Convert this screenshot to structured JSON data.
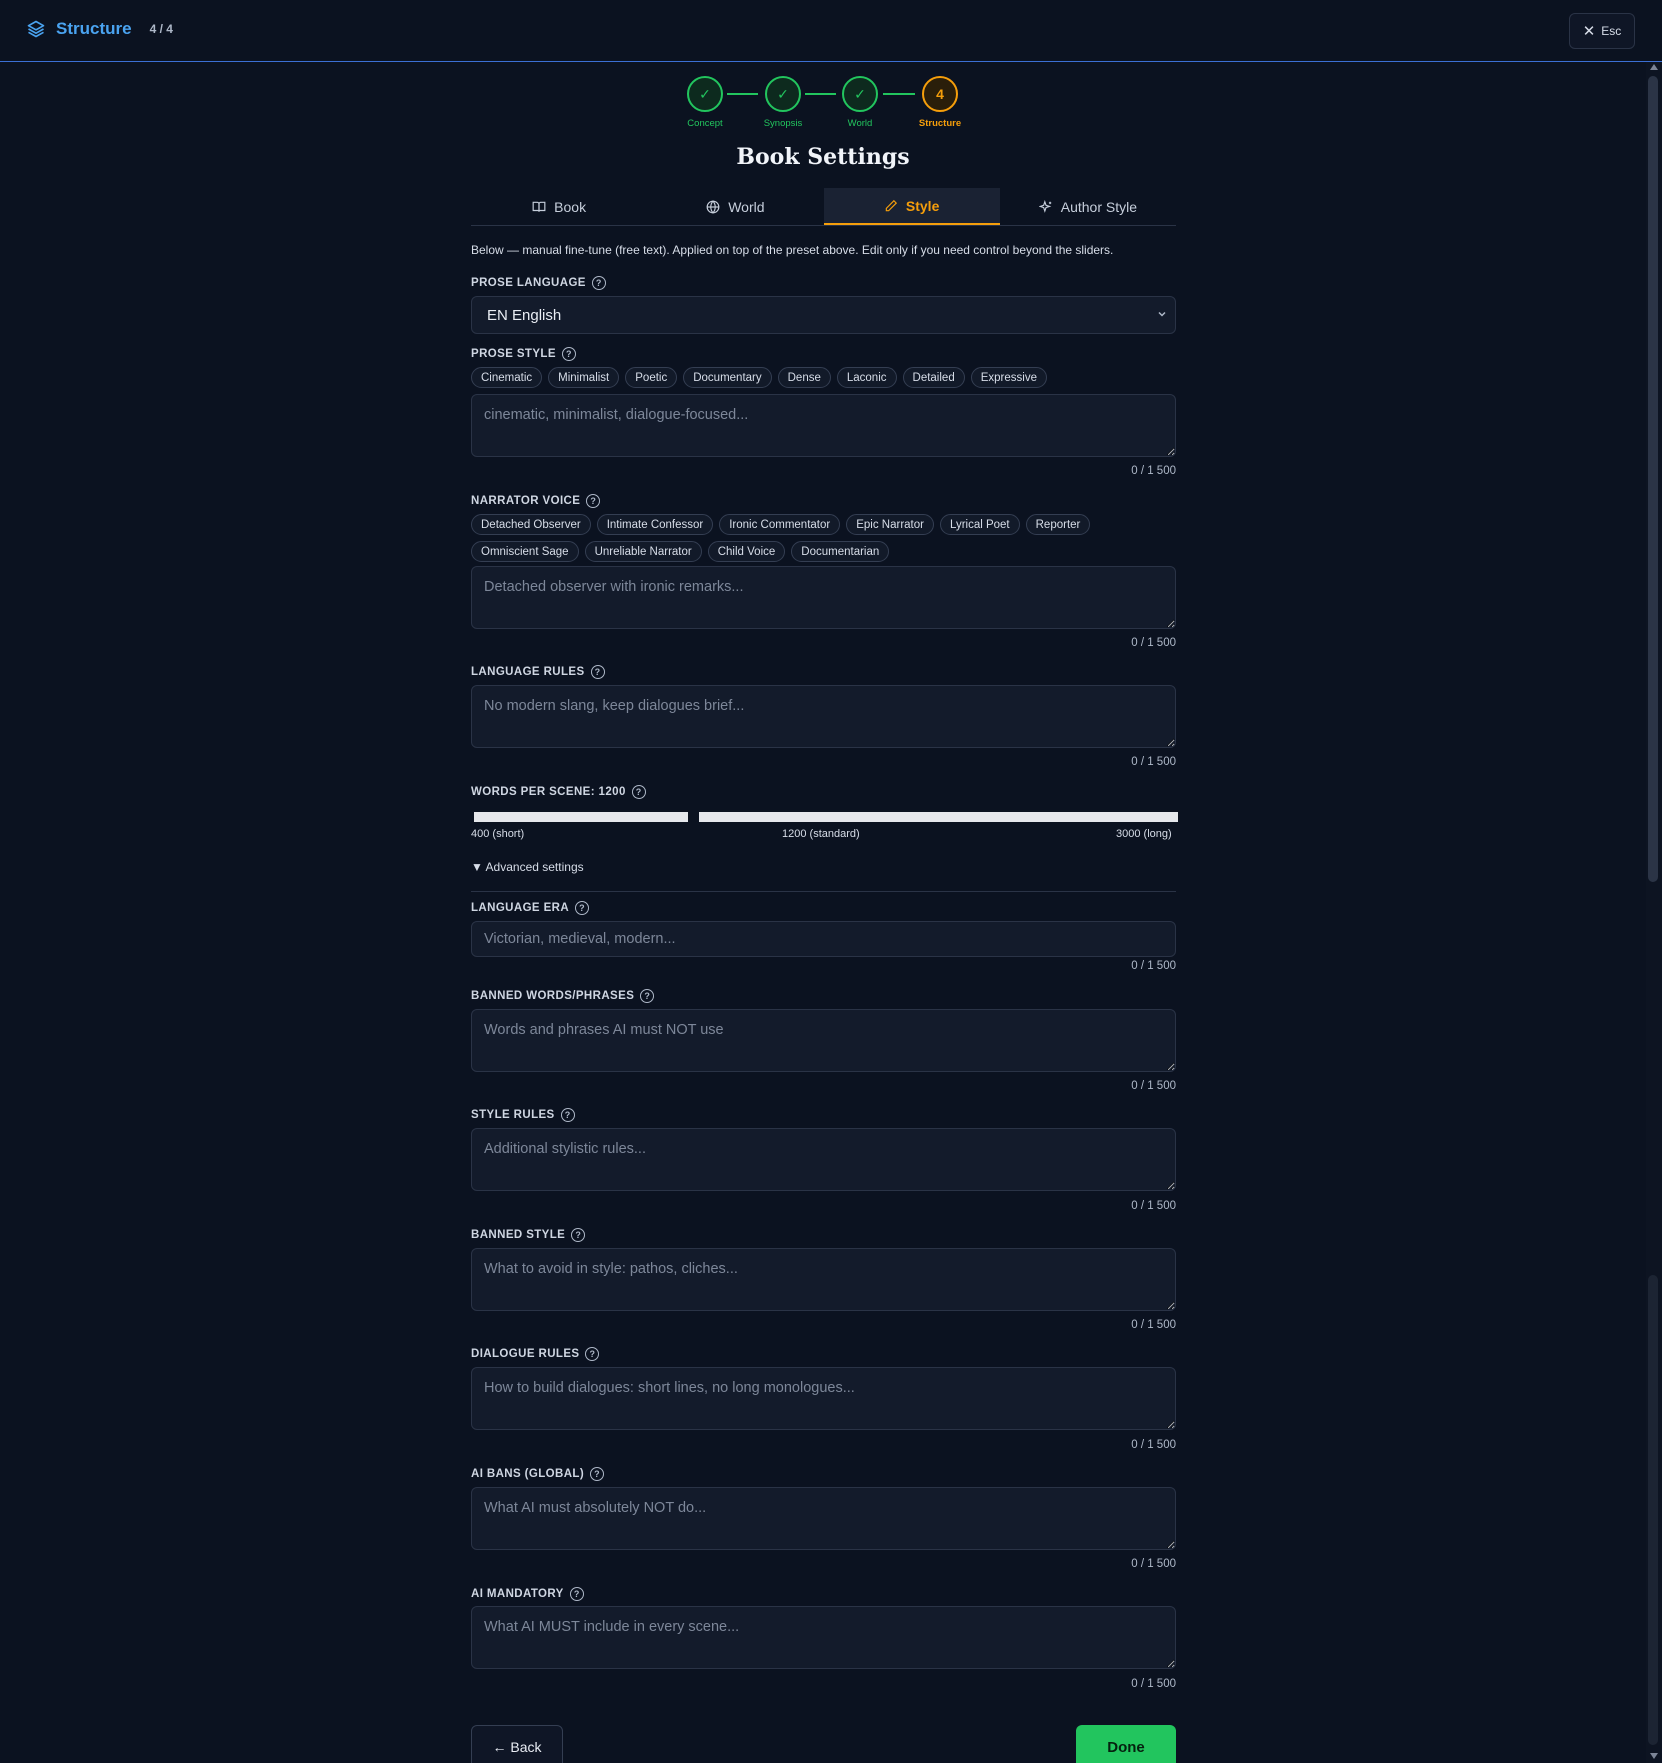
{
  "header": {
    "title": "Structure",
    "step_counter": "4 / 4",
    "esc_label": "Esc"
  },
  "stepper": {
    "steps": [
      {
        "label": "Concept",
        "state": "done"
      },
      {
        "label": "Synopsis",
        "state": "done"
      },
      {
        "label": "World",
        "state": "done"
      },
      {
        "label": "Structure",
        "state": "active",
        "number": "4"
      }
    ]
  },
  "page_title": "Book Settings",
  "tabs": [
    {
      "label": "Book",
      "icon": "book-icon"
    },
    {
      "label": "World",
      "icon": "globe-icon"
    },
    {
      "label": "Style",
      "icon": "pen-icon",
      "active": true
    },
    {
      "label": "Author Style",
      "icon": "sparkles-icon"
    }
  ],
  "intro": "Below — manual fine-tune (free text). Applied on top of the preset above. Edit only if you need control beyond the sliders.",
  "prose_language": {
    "label": "PROSE LANGUAGE",
    "value": "EN English"
  },
  "prose_style": {
    "label": "PROSE STYLE",
    "chips": [
      "Cinematic",
      "Minimalist",
      "Poetic",
      "Documentary",
      "Dense",
      "Laconic",
      "Detailed",
      "Expressive"
    ],
    "placeholder": "cinematic, minimalist, dialogue-focused...",
    "counter": "0 / 1 500"
  },
  "narrator_voice": {
    "label": "NARRATOR VOICE",
    "chips": [
      "Detached Observer",
      "Intimate Confessor",
      "Ironic Commentator",
      "Epic Narrator",
      "Lyrical Poet",
      "Reporter",
      "Omniscient Sage",
      "Unreliable Narrator",
      "Child Voice",
      "Documentarian"
    ],
    "placeholder": "Detached observer with ironic remarks...",
    "counter": "0 / 1 500"
  },
  "language_rules": {
    "label": "LANGUAGE RULES",
    "placeholder": "No modern slang, keep dialogues brief...",
    "counter": "0 / 1 500"
  },
  "words_per_scene": {
    "label": "WORDS PER SCENE: 1200",
    "value": 1200,
    "min_label": "400 (short)",
    "mid_label": "1200 (standard)",
    "max_label": "3000 (long)"
  },
  "advanced_toggle": "▼ Advanced settings",
  "language_era": {
    "label": "LANGUAGE ERA",
    "placeholder": "Victorian, medieval, modern...",
    "counter": "0 / 1 500"
  },
  "banned_words": {
    "label": "BANNED WORDS/PHRASES",
    "placeholder": "Words and phrases AI must NOT use",
    "counter": "0 / 1 500"
  },
  "style_rules": {
    "label": "STYLE RULES",
    "placeholder": "Additional stylistic rules...",
    "counter": "0 / 1 500"
  },
  "banned_style": {
    "label": "BANNED STYLE",
    "placeholder": "What to avoid in style: pathos, cliches...",
    "counter": "0 / 1 500"
  },
  "dialogue_rules": {
    "label": "DIALOGUE RULES",
    "placeholder": "How to build dialogues: short lines, no long monologues...",
    "counter": "0 / 1 500"
  },
  "ai_bans": {
    "label": "AI BANS (GLOBAL)",
    "placeholder": "What AI must absolutely NOT do...",
    "counter": "0 / 1 500"
  },
  "ai_mandatory": {
    "label": "AI MANDATORY",
    "placeholder": "What AI MUST include in every scene...",
    "counter": "0 / 1 500"
  },
  "footer": {
    "back_label": "← Back",
    "done_label": "Done"
  },
  "colors": {
    "background": "#0b1220",
    "accent_blue": "#4aa3f0",
    "done_green": "#22c55e",
    "active_orange": "#f59e0b"
  }
}
